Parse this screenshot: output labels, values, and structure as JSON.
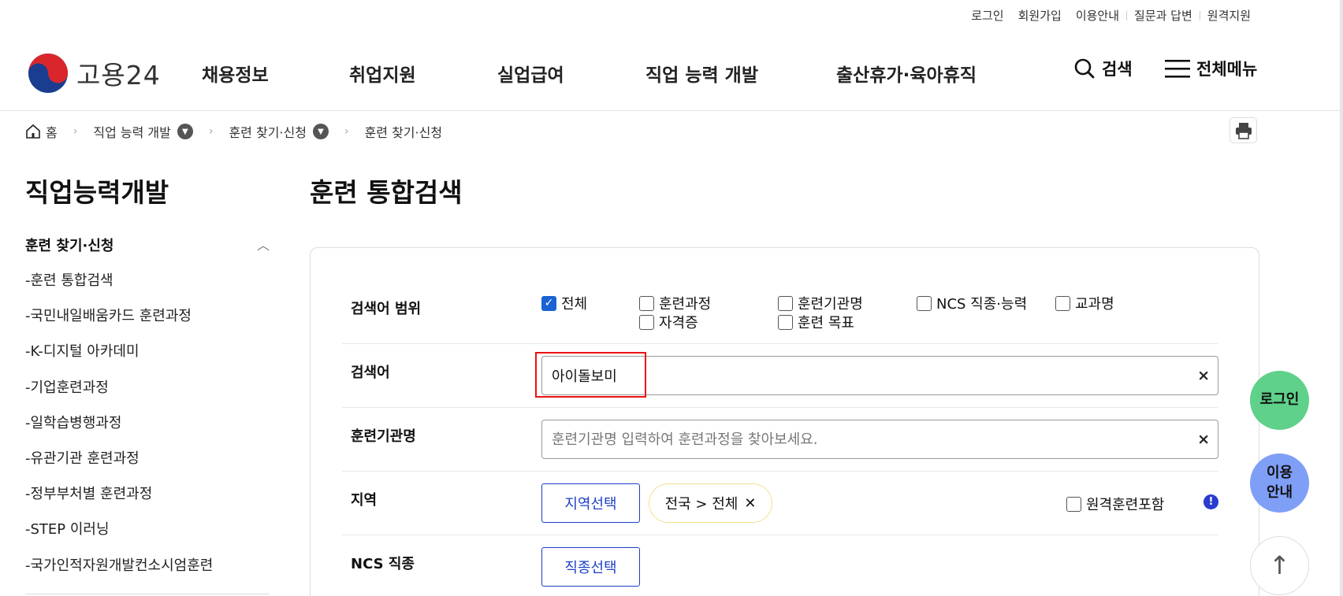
{
  "utility": [
    "로그인",
    "회원가입",
    "이용안내",
    "질문과 답변",
    "원격지원"
  ],
  "logo": {
    "text": "고용24"
  },
  "gnb": {
    "menu": [
      "채용정보",
      "취업지원",
      "실업급여",
      "직업 능력 개발",
      "출산휴가·육아휴직"
    ],
    "search": "검색",
    "all_menu": "전체메뉴"
  },
  "breadcrumb": {
    "home": "홈",
    "level1": "직업 능력 개발",
    "level2": "훈련 찾기·신청",
    "current": "훈련 찾기·신청"
  },
  "sidebar": {
    "title": "직업능력개발",
    "section": "훈련 찾기·신청",
    "items": [
      "-훈련 통합검색",
      "-국민내일배움카드 훈련과정",
      "-K-디지털 아카데미",
      "-기업훈련과정",
      "-일학습병행과정",
      "-유관기관 훈련과정",
      "-정부부처별 훈련과정",
      "-STEP 이러닝",
      "-국가인적자원개발컨소시엄훈련"
    ]
  },
  "main": {
    "title": "훈련 통합검색",
    "scope": {
      "label": "검색어 범위",
      "options": [
        {
          "label": "전체",
          "checked": true
        },
        {
          "label": "훈련과정",
          "checked": false
        },
        {
          "label": "훈련기관명",
          "checked": false
        },
        {
          "label": "NCS 직종·능력",
          "checked": false
        },
        {
          "label": "교과명",
          "checked": false
        },
        {
          "label": "자격증",
          "checked": false
        },
        {
          "label": "훈련 목표",
          "checked": false
        }
      ]
    },
    "keyword": {
      "label": "검색어",
      "value": "아이돌보미"
    },
    "institution": {
      "label": "훈련기관명",
      "placeholder": "훈련기관명 입력하여 훈련과정을 찾아보세요."
    },
    "region": {
      "label": "지역",
      "button": "지역선택",
      "chip": "전국 > 전체",
      "remote": "원격훈련포함"
    },
    "ncs": {
      "label": "NCS 직종",
      "button": "직종선택"
    },
    "clear_symbol": "×"
  },
  "floating": {
    "login": "로그인",
    "guide_line1": "이용",
    "guide_line2": "안내",
    "top": "↑"
  },
  "colors": {
    "primary": "#1b3fc7",
    "checkbox": "#1b62d4",
    "login_fab": "#5fd18a",
    "guide_fab": "#7f9ff7",
    "highlight": "#ee1111"
  }
}
